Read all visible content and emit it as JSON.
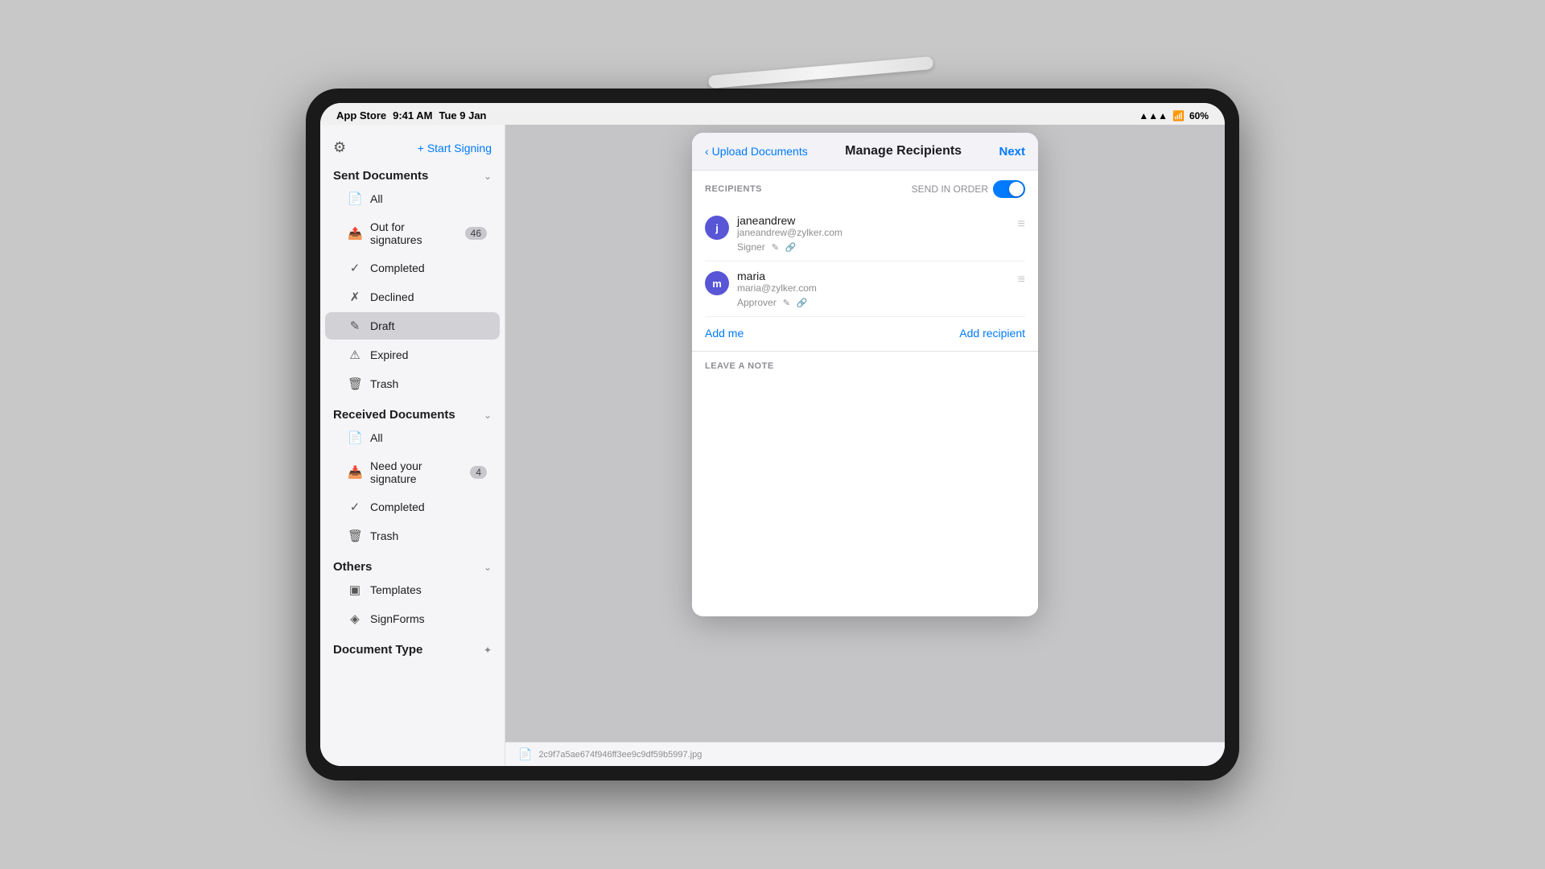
{
  "statusBar": {
    "storeLabel": "App Store",
    "time": "9:41 AM",
    "date": "Tue 9 Jan",
    "signal": "▲▲▲",
    "wifi": "wifi",
    "battery": "60%"
  },
  "sidebar": {
    "gearIcon": "⚙",
    "startSigning": "+ Start Signing",
    "sentDocuments": {
      "title": "Sent Documents",
      "items": [
        {
          "label": "All",
          "icon": "📄",
          "badge": ""
        },
        {
          "label": "Out for signatures",
          "icon": "📤",
          "badge": "46"
        },
        {
          "label": "Completed",
          "icon": "✓",
          "badge": ""
        },
        {
          "label": "Declined",
          "icon": "✗",
          "badge": ""
        },
        {
          "label": "Draft",
          "icon": "✎",
          "badge": ""
        },
        {
          "label": "Expired",
          "icon": "⚠",
          "badge": ""
        },
        {
          "label": "Trash",
          "icon": "🗑",
          "badge": ""
        }
      ]
    },
    "receivedDocuments": {
      "title": "Received Documents",
      "items": [
        {
          "label": "All",
          "icon": "📄",
          "badge": ""
        },
        {
          "label": "Need your signature",
          "icon": "📥",
          "badge": "4"
        },
        {
          "label": "Completed",
          "icon": "✓",
          "badge": ""
        },
        {
          "label": "Trash",
          "icon": "🗑",
          "badge": ""
        }
      ]
    },
    "others": {
      "title": "Others",
      "items": [
        {
          "label": "Templates",
          "icon": "▣",
          "badge": ""
        },
        {
          "label": "SignForms",
          "icon": "◈",
          "badge": ""
        }
      ]
    },
    "documentType": {
      "title": "Document Type",
      "icon": "✦"
    }
  },
  "modal": {
    "backLabel": "Upload Documents",
    "title": "Manage Recipients",
    "nextLabel": "Next",
    "recipientsLabel": "RECIPIENTS",
    "sendInOrderLabel": "SEND IN ORDER",
    "recipients": [
      {
        "name": "janeandrew",
        "email": "janeandrew@zylker.com",
        "role": "Signer",
        "avatarInitial": "j",
        "avatarColor": "#5856D6"
      },
      {
        "name": "maria",
        "email": "maria@zylker.com",
        "role": "Approver",
        "avatarInitial": "m",
        "avatarColor": "#5856D6"
      }
    ],
    "addMeLabel": "Add me",
    "addRecipientLabel": "Add recipient",
    "leaveNoteLabel": "LEAVE A NOTE",
    "noteValue": ""
  },
  "bottomBar": {
    "fileLabel": "2c9f7a5ae674f946ff3ee9c9df59b5997.jpg"
  }
}
